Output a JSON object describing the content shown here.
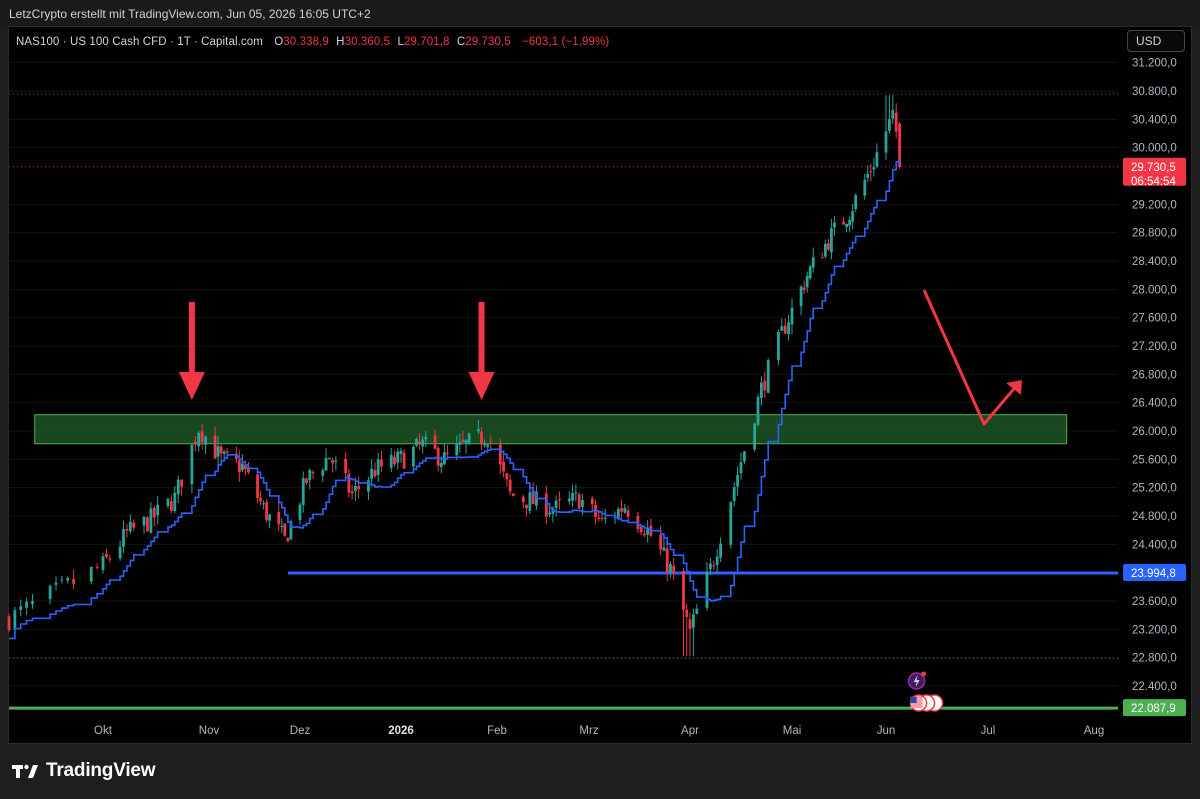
{
  "header": {
    "attribution": "LetzCrypto erstellt mit TradingView.com, Jun 05, 2026 16:05 UTC+2"
  },
  "legend": {
    "symbol": "NAS100 · US 100 Cash CFD · 1T · Capital.com",
    "open_label": "O",
    "open": "30.338,9",
    "high_label": "H",
    "high": "30.360,5",
    "low_label": "L",
    "low": "29.701,8",
    "close_label": "C",
    "close": "29.730,5",
    "change": "−603,1 (−1,99%)"
  },
  "currency_button": "USD",
  "brand": {
    "name": "TradingView"
  },
  "colors": {
    "up": "#26a69a",
    "down": "#f23645",
    "ma_line": "#2962ff",
    "support_line": "#2962ff",
    "zone_fill": "#1e5a28",
    "zone_border": "#4caf50",
    "arrow": "#f23645",
    "green_line": "#4caf50"
  },
  "chart_data": {
    "type": "candlestick",
    "y_unit": "USD",
    "yaxis_ticks": [
      "31.200,0",
      "30.800,0",
      "30.400,0",
      "30.000,0",
      "29.200,0",
      "28.800,0",
      "28.400,0",
      "28.000,0",
      "27.600,0",
      "27.200,0",
      "26.800,0",
      "26.400,0",
      "26.000,0",
      "25.600,0",
      "25.200,0",
      "24.800,0",
      "24.400,0",
      "23.600,0",
      "23.200,0",
      "22.800,0",
      "22.400,0"
    ],
    "ytick_values": [
      31200,
      30800,
      30400,
      30000,
      29200,
      28800,
      28400,
      28000,
      27600,
      27200,
      26800,
      26400,
      26000,
      25600,
      25200,
      24800,
      24400,
      23600,
      23200,
      22800,
      22400
    ],
    "ylim": [
      22050,
      31400
    ],
    "xaxis_ticks": [
      "Okt",
      "Nov",
      "Dez",
      "2026",
      "Feb",
      "Mrz",
      "Apr",
      "Mai",
      "Jun",
      "Jul",
      "Aug"
    ],
    "xaxis_bold": "2026",
    "last_price_label": "29.730,5",
    "countdown_label": "06:54:54",
    "last_price": 29730.5,
    "support_level_label": "23.994,8",
    "support_level": 23994.8,
    "green_level_label": "22.087,9",
    "green_level": 22087.9,
    "dotted_high": 30760,
    "dotted_low": 22790,
    "resistance_zone": {
      "low": 25820,
      "high": 26230
    },
    "price_path": [
      [
        "2025-09-15",
        23350
      ],
      [
        "2025-10-01",
        24100
      ],
      [
        "2025-10-08",
        24550
      ],
      [
        "2025-10-15",
        24750
      ],
      [
        "2025-10-22",
        25050
      ],
      [
        "2025-10-29",
        26050
      ],
      [
        "2025-11-05",
        25600
      ],
      [
        "2025-11-12",
        25500
      ],
      [
        "2025-11-19",
        24900
      ],
      [
        "2025-11-26",
        24450
      ],
      [
        "2025-12-03",
        25300
      ],
      [
        "2025-12-10",
        25650
      ],
      [
        "2025-12-17",
        25100
      ],
      [
        "2025-12-24",
        25450
      ],
      [
        "2026-01-01",
        25600
      ],
      [
        "2026-01-08",
        25800
      ],
      [
        "2026-01-15",
        25600
      ],
      [
        "2026-01-22",
        25800
      ],
      [
        "2026-01-29",
        25950
      ],
      [
        "2026-02-05",
        25100
      ],
      [
        "2026-02-12",
        25000
      ],
      [
        "2026-02-19",
        24900
      ],
      [
        "2026-02-26",
        25050
      ],
      [
        "2026-03-05",
        24700
      ],
      [
        "2026-03-12",
        24950
      ],
      [
        "2026-03-19",
        24600
      ],
      [
        "2026-03-26",
        24050
      ],
      [
        "2026-04-01",
        23150
      ],
      [
        "2026-04-08",
        24200
      ],
      [
        "2026-04-15",
        25400
      ],
      [
        "2026-04-22",
        26600
      ],
      [
        "2026-04-29",
        27500
      ],
      [
        "2026-05-06",
        28200
      ],
      [
        "2026-05-13",
        28700
      ],
      [
        "2026-05-20",
        29100
      ],
      [
        "2026-05-27",
        29700
      ],
      [
        "2026-06-03",
        30450
      ],
      [
        "2026-06-05",
        29730
      ]
    ]
  }
}
